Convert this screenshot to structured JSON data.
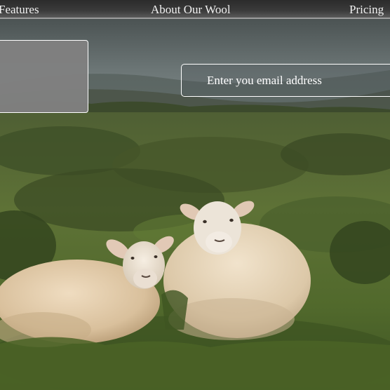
{
  "nav": {
    "items": [
      {
        "label": "Features"
      },
      {
        "label": "About Our Wool"
      },
      {
        "label": "Pricing"
      }
    ]
  },
  "signup": {
    "email_placeholder": "Enter you email address"
  },
  "colors": {
    "nav_background": "#333333",
    "nav_text": "#f2f2f2",
    "box_fill": "#808080",
    "field_border": "#ffffff"
  }
}
